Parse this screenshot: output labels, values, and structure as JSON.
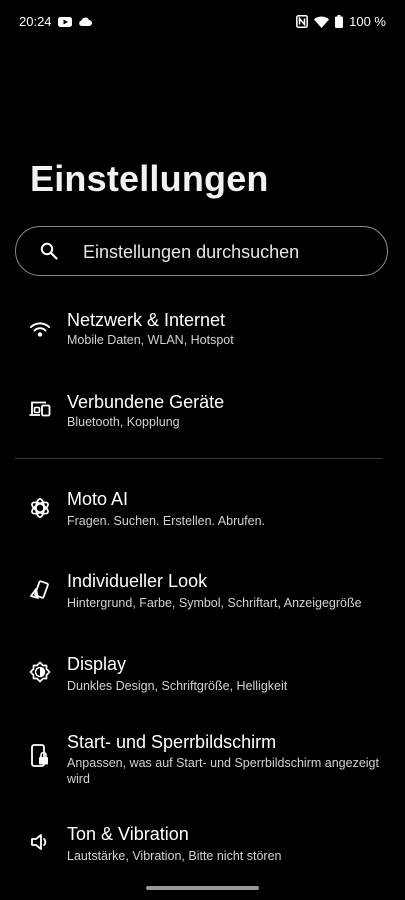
{
  "status_bar": {
    "time": "20:24",
    "left_icons": [
      "youtube-icon",
      "cloud-icon"
    ],
    "right_icons": [
      "nfc-icon",
      "wifi-icon",
      "battery-icon"
    ],
    "battery": "100 %"
  },
  "header": {
    "title": "Einstellungen"
  },
  "search": {
    "placeholder": "Einstellungen durchsuchen",
    "icon": "search-icon"
  },
  "items": [
    {
      "icon": "wifi-icon",
      "title": "Netzwerk & Internet",
      "subtitle": "Mobile Daten, WLAN, Hotspot"
    },
    {
      "icon": "connected-devices-icon",
      "title": "Verbundene Geräte",
      "subtitle": "Bluetooth, Kopplung"
    },
    {
      "icon": "moto-ai-icon",
      "title": "Moto AI",
      "subtitle": "Fragen. Suchen. Erstellen. Abrufen."
    },
    {
      "icon": "personalize-icon",
      "title": "Individueller Look",
      "subtitle": "Hintergrund, Farbe, Symbol, Schriftart, Anzeigegröße"
    },
    {
      "icon": "display-icon",
      "title": "Display",
      "subtitle": "Dunkles Design, Schriftgröße, Helligkeit"
    },
    {
      "icon": "lockscreen-icon",
      "title": "Start- und Sperrbildschirm",
      "subtitle": "Anpassen, was auf Start- und Sperrbildschirm angezeigt wird"
    },
    {
      "icon": "sound-icon",
      "title": "Ton & Vibration",
      "subtitle": "Lautstärke, Vibration, Bitte nicht stören"
    }
  ]
}
